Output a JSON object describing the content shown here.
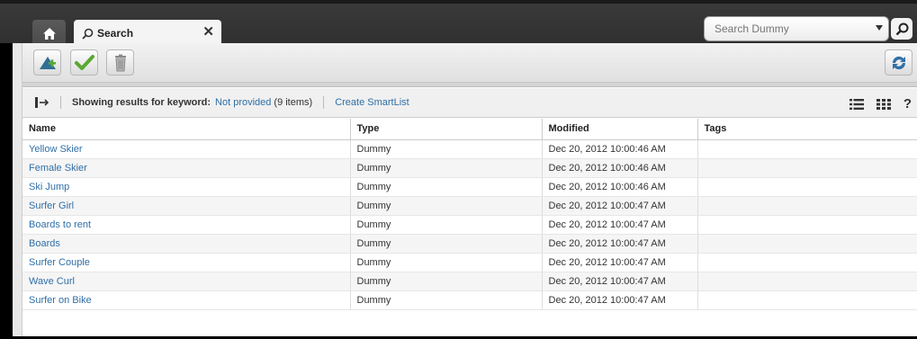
{
  "tabs": {
    "search_label": "Search"
  },
  "search": {
    "placeholder": "Search Dummy"
  },
  "infobar": {
    "prefix": "Showing results for keyword:",
    "keyword": "Not provided",
    "count": "(9 items)",
    "create_smartlist": "Create SmartList",
    "help": "?"
  },
  "table": {
    "headers": [
      "Name",
      "Type",
      "Modified",
      "Tags"
    ],
    "rows": [
      {
        "name": "Yellow Skier",
        "type": "Dummy",
        "modified": "Dec 20, 2012 10:00:46 AM",
        "tags": ""
      },
      {
        "name": "Female Skier",
        "type": "Dummy",
        "modified": "Dec 20, 2012 10:00:46 AM",
        "tags": ""
      },
      {
        "name": "Ski Jump",
        "type": "Dummy",
        "modified": "Dec 20, 2012 10:00:46 AM",
        "tags": ""
      },
      {
        "name": "Surfer Girl",
        "type": "Dummy",
        "modified": "Dec 20, 2012 10:00:47 AM",
        "tags": ""
      },
      {
        "name": "Boards to rent",
        "type": "Dummy",
        "modified": "Dec 20, 2012 10:00:47 AM",
        "tags": ""
      },
      {
        "name": "Boards",
        "type": "Dummy",
        "modified": "Dec 20, 2012 10:00:47 AM",
        "tags": ""
      },
      {
        "name": "Surfer Couple",
        "type": "Dummy",
        "modified": "Dec 20, 2012 10:00:47 AM",
        "tags": ""
      },
      {
        "name": "Wave Curl",
        "type": "Dummy",
        "modified": "Dec 20, 2012 10:00:47 AM",
        "tags": ""
      },
      {
        "name": "Surfer on Bike",
        "type": "Dummy",
        "modified": "Dec 20, 2012 10:00:47 AM",
        "tags": ""
      }
    ]
  },
  "icons": {
    "home": "home-icon",
    "search": "search-icon",
    "close": "close-icon",
    "add": "add-icon",
    "approve": "checkmark-icon",
    "delete": "trash-icon",
    "refresh": "refresh-icon",
    "expand": "expand-panel-icon",
    "list_view": "list-view-icon",
    "grid_view": "grid-view-icon"
  },
  "colors": {
    "link": "#2f6fa8",
    "topbar": "#333333",
    "check_green": "#5aa832"
  }
}
